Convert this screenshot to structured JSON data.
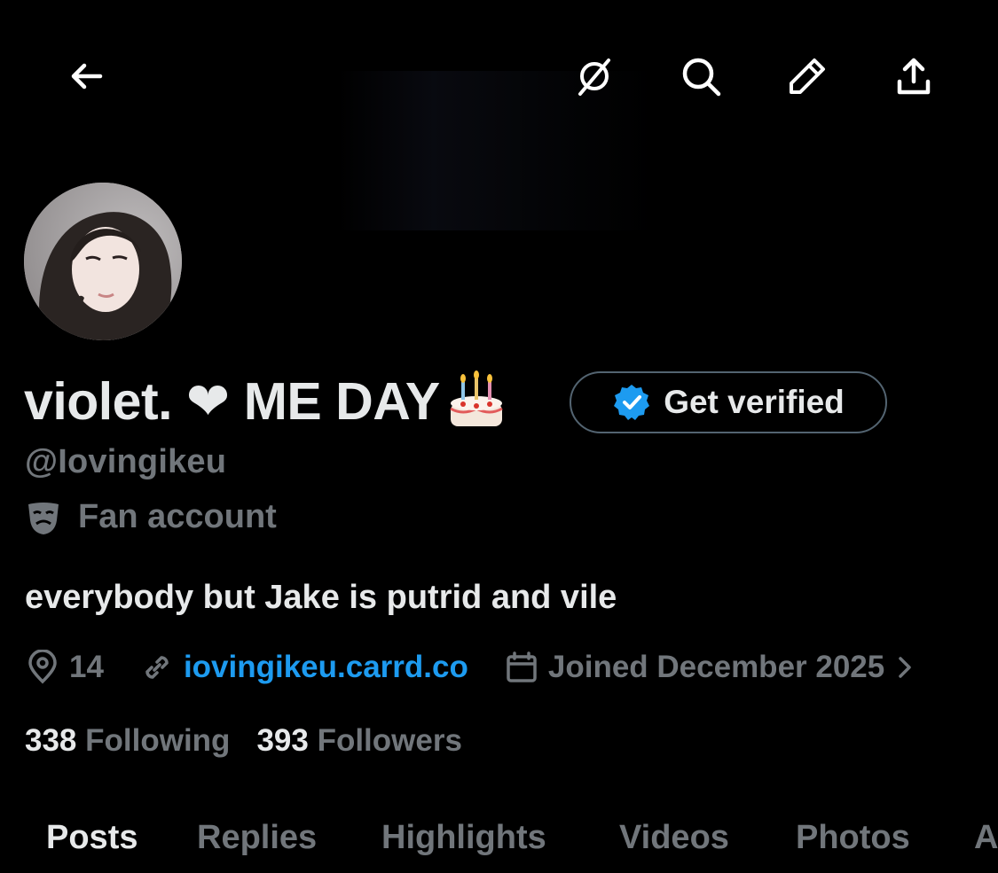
{
  "profile": {
    "display_name": "violet. ❤ ME DAY",
    "handle": "@Iovingikeu",
    "category": "Fan account",
    "bio": "everybody but Jake is putrid and vile",
    "location": "14",
    "website": "iovingikeu.carrd.co",
    "joined": "Joined December 2025",
    "following_count": "338",
    "following_label": "Following",
    "followers_count": "393",
    "followers_label": "Followers"
  },
  "verify_button": {
    "label": "Get verified"
  },
  "tabs": [
    {
      "label": "Posts",
      "active": true
    },
    {
      "label": "Replies"
    },
    {
      "label": "Highlights"
    },
    {
      "label": "Videos"
    },
    {
      "label": "Photos"
    },
    {
      "label": "A"
    }
  ],
  "icons": {
    "back": "arrow-left-icon",
    "grok": "grok-icon",
    "search": "search-icon",
    "edit": "pencil-icon",
    "share": "share-icon",
    "badge": "verified-badge-icon",
    "category": "theater-masks-icon",
    "location": "location-pin-icon",
    "link": "link-icon",
    "calendar": "calendar-icon",
    "chevron": "chevron-right-icon",
    "cake": "birthday-cake-icon"
  },
  "colors": {
    "background": "#000000",
    "primary_text": "#e7e9ea",
    "secondary_text": "#71767b",
    "link": "#1d9bf0",
    "badge": "#1d9bf0"
  }
}
